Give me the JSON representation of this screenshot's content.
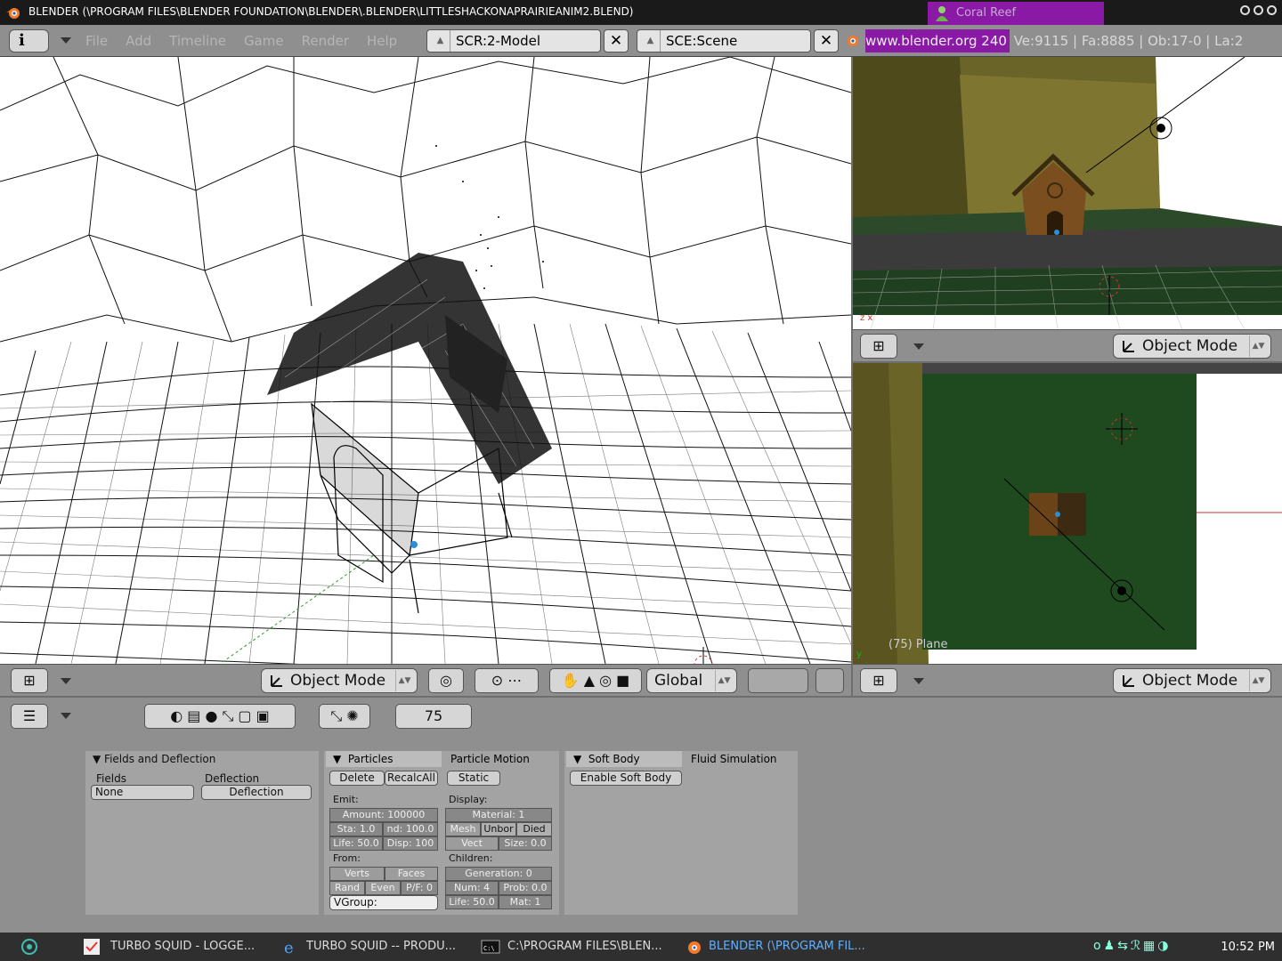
{
  "window": {
    "title": "BLENDER (\\PROGRAM FILES\\BLENDER FOUNDATION\\BLENDER\\.BLENDER\\LITTLESHACKONAPRAIRIEANIM2.BLEND)",
    "notification": "Coral Reef"
  },
  "menubar": {
    "info_label": "i",
    "menus": [
      "File",
      "Add",
      "Timeline",
      "Game",
      "Render",
      "Help"
    ],
    "screen": "SCR:2-Model",
    "scene": "SCE:Scene",
    "url": "www.blender.org 240",
    "stats": " Ve:9115 | Fa:8885 | Ob:17-0 | La:2"
  },
  "main_view": {
    "mode": "Object Mode",
    "orientation": "Global"
  },
  "camera_view": {
    "mode": "Object Mode"
  },
  "top_view": {
    "mode": "Object Mode",
    "label": "(75) Plane"
  },
  "buttons": {
    "frame": "75",
    "fields_panel": {
      "title": "Fields and Deflection",
      "fields_label": "Fields",
      "deflection_label": "Deflection",
      "fields_value": "None",
      "deflection_btn": "Deflection"
    },
    "particles_panel": {
      "tab1": "Particles",
      "tab2": "Particle Motion",
      "delete": "Delete",
      "recalc": "RecalcAll",
      "static": "Static",
      "emit_label": "Emit:",
      "amount": "Amount: 100000",
      "sta": "Sta: 1.0",
      "end": "nd: 100.0",
      "life": "Life: 50.0",
      "disp": "Disp: 100",
      "from_label": "From:",
      "verts": "Verts",
      "faces": "Faces",
      "rand": "Rand",
      "even": "Even",
      "pf": "P/F: 0",
      "vgroup": "VGroup:",
      "display_label": "Display:",
      "material": "Material: 1",
      "mesh": "Mesh",
      "unborn": "Unbor",
      "died": "Died",
      "vect": "Vect",
      "size": "Size: 0.0",
      "children_label": "Children:",
      "generation": "Generation: 0",
      "num": "Num: 4",
      "prob": "Prob: 0.0",
      "child_life": "Life: 50.0",
      "mat": "Mat: 1"
    },
    "softbody_panel": {
      "tab1": "Soft Body",
      "tab2": "Fluid Simulation",
      "enable": "Enable Soft Body"
    }
  },
  "taskbar": {
    "tasks": [
      "TURBO SQUID - LOGGE...",
      "TURBO SQUID -- PRODU...",
      "C:\\PROGRAM FILES\\BLEN...",
      "BLENDER (\\PROGRAM FIL..."
    ],
    "clock": "10:52 PM"
  },
  "colors": {
    "panel_bg": "#a3a3a3",
    "header_bg": "#8f8f8f",
    "grass": "#1f4a1f",
    "cliff": "#6b6428",
    "highlight": "#8a1aa6"
  }
}
